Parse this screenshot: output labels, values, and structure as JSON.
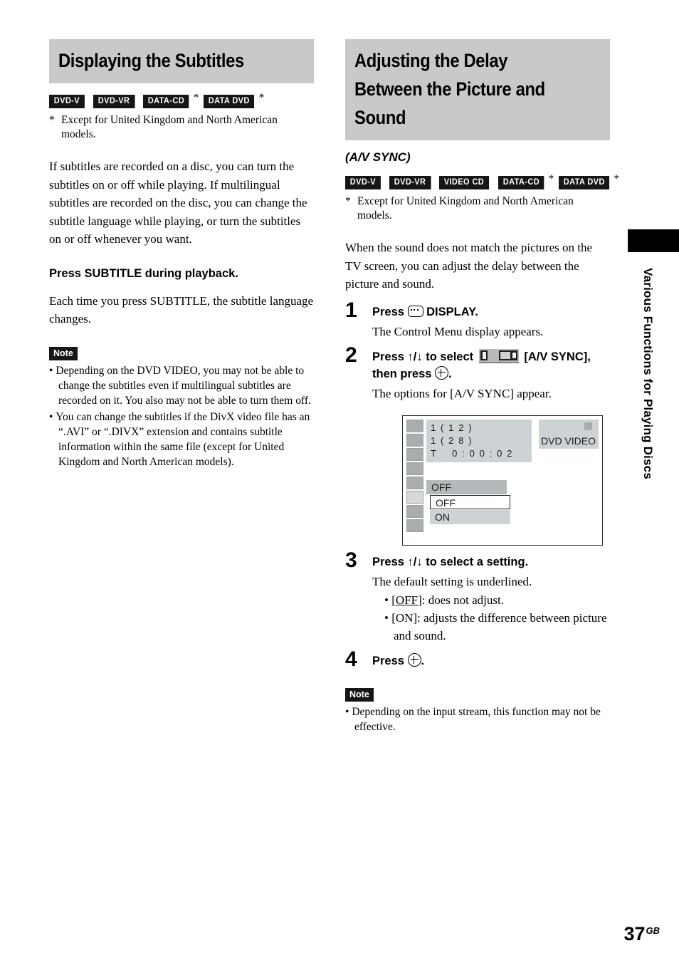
{
  "left_column": {
    "heading": "Displaying the Subtitles",
    "badges": [
      {
        "label": "DVD-V",
        "star": ""
      },
      {
        "label": "DVD-VR",
        "star": ""
      },
      {
        "label": "DATA-CD",
        "star": "*"
      },
      {
        "label": "DATA DVD",
        "star": "*"
      }
    ],
    "footnote_mark": "*",
    "footnote_text": "Except for United Kingdom and North American models.",
    "intro": "If subtitles are recorded on a disc, you can turn the subtitles on or off while playing. If multilingual subtitles are recorded on the disc, you can change the subtitle language while playing, or turn the subtitles on or off whenever you want.",
    "instruction_bold": "Press SUBTITLE during playback.",
    "instruction_body": "Each time you press SUBTITLE, the subtitle language changes.",
    "note_label": "Note",
    "notes": [
      "Depending on the DVD VIDEO, you may not be able to change the subtitles even if multilingual subtitles are recorded on it. You also may not be able to turn them off.",
      "You can change the subtitles if the DivX video file has an “.AVI” or “.DIVX” extension and contains subtitle information within the same file (except for United Kingdom and North American models)."
    ]
  },
  "right_column": {
    "heading": "Adjusting the Delay Between the Picture and Sound",
    "subheading": "(A/V SYNC)",
    "badges": [
      {
        "label": "DVD-V",
        "star": ""
      },
      {
        "label": "DVD-VR",
        "star": ""
      },
      {
        "label": "VIDEO CD",
        "star": ""
      },
      {
        "label": "DATA-CD",
        "star": "*"
      },
      {
        "label": "DATA DVD",
        "star": "*"
      }
    ],
    "footnote_mark": "*",
    "footnote_text": "Except for United Kingdom and North American models.",
    "intro": "When the sound does not match the pictures on the TV screen, you can adjust the delay between the picture and sound.",
    "steps": [
      {
        "num": "1",
        "title_before": "Press ",
        "title_after": " DISPLAY.",
        "desc": "The Control Menu display appears."
      },
      {
        "num": "2",
        "title_before": "Press ↑/↓ to select ",
        "title_mid": " [A/V SYNC], then press ",
        "title_after": ".",
        "desc": "The options for [A/V SYNC] appear."
      },
      {
        "num": "3",
        "title": "Press ↑/↓ to select a setting.",
        "desc": "The default setting is underlined.",
        "bullets": [
          {
            "key": "OFF",
            "underline": true,
            "text": ": does not adjust."
          },
          {
            "key": "ON",
            "underline": false,
            "text": ": adjusts the difference between picture and sound."
          }
        ]
      },
      {
        "num": "4",
        "title_before": "Press ",
        "title_after": "."
      }
    ],
    "note_label": "Note",
    "notes": [
      "Depending on the input stream, this function may not be effective."
    ]
  },
  "screen_illustration": {
    "info_lines": [
      "1 ( 1 2 )",
      "1 ( 2 8 )",
      "T    0 : 0 0 : 0 2"
    ],
    "disc_label": "DVD VIDEO",
    "current_value": "OFF",
    "options": [
      {
        "label": "OFF",
        "selected": true
      },
      {
        "label": "ON",
        "selected": false
      }
    ],
    "icon_strip_count": 8,
    "icon_strip_active_index": 5
  },
  "side_tab": {
    "text": "Various Functions for Playing Discs"
  },
  "page_number": {
    "number": "37",
    "suffix": "GB"
  }
}
